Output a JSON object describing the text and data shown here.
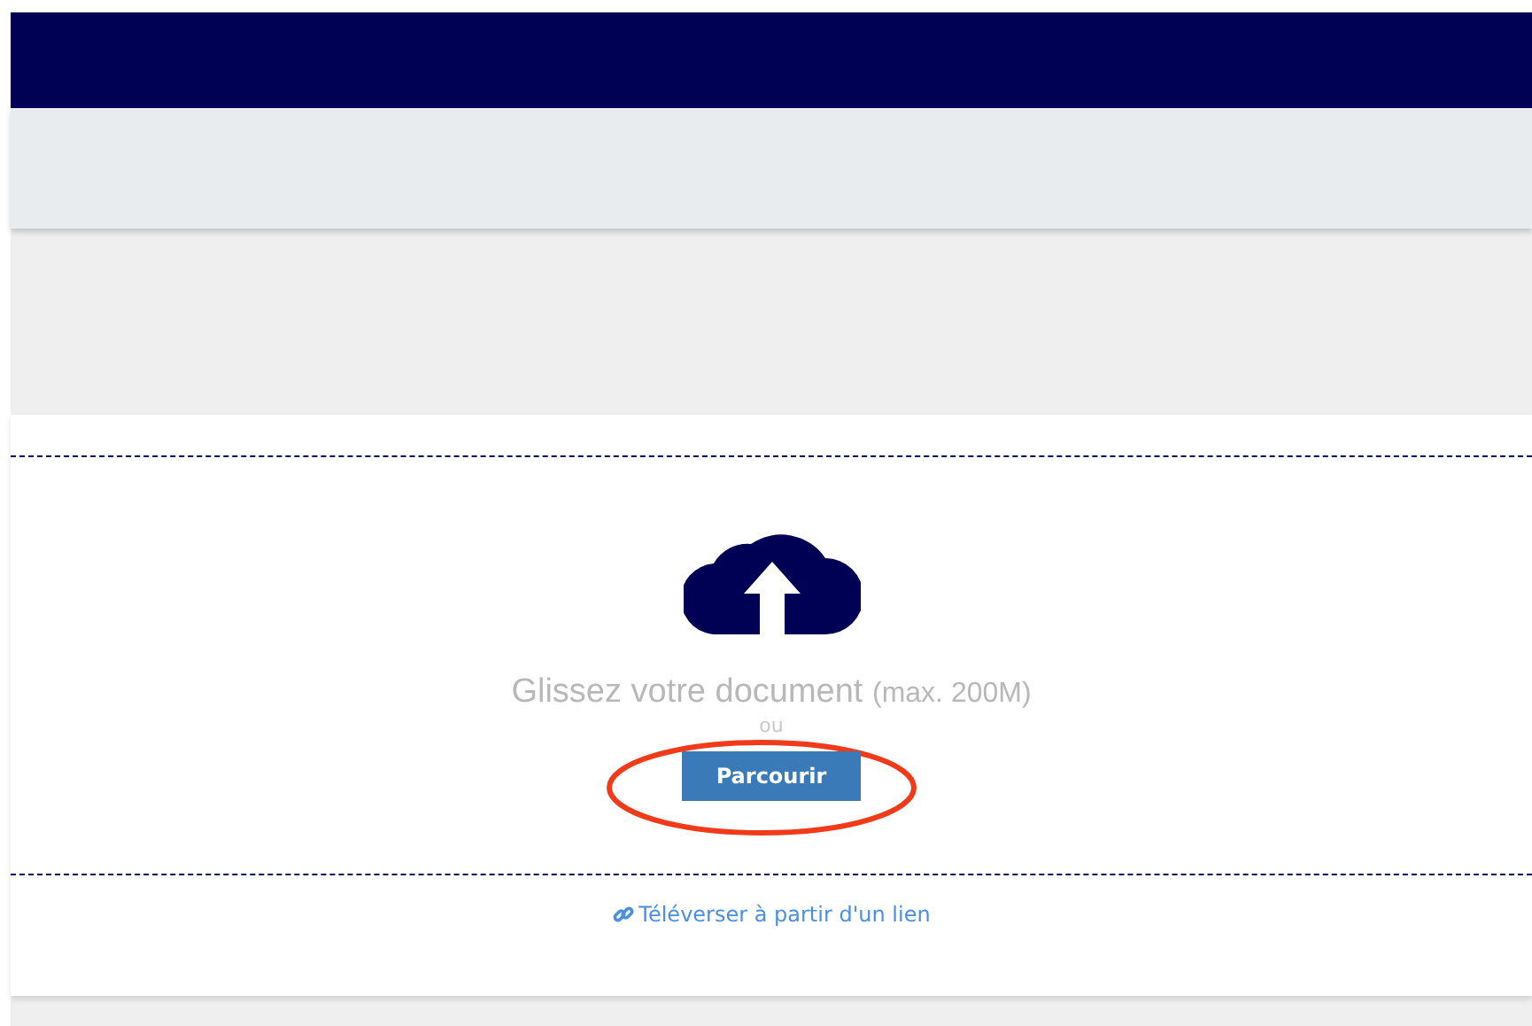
{
  "upload": {
    "message": "Glissez votre document",
    "limit": "(max. 200M)",
    "separator": "ou",
    "button": "Parcourir"
  },
  "link": {
    "label": "Téléverser à partir d'un lien"
  }
}
